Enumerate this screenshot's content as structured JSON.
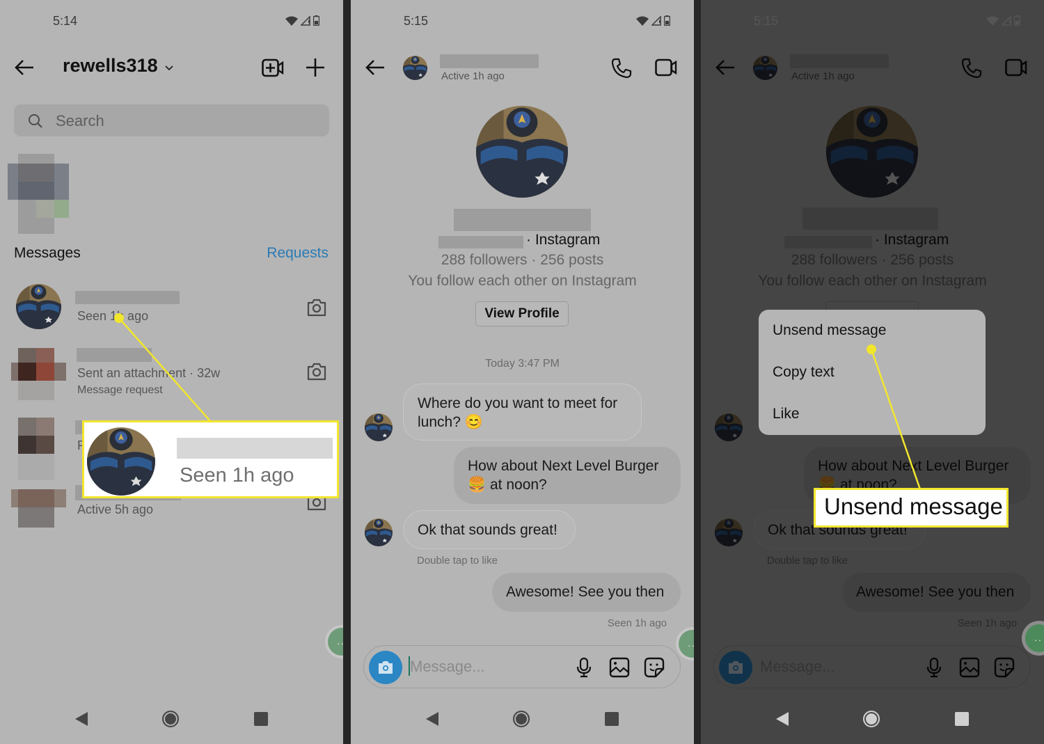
{
  "panel1": {
    "status_time": "5:14",
    "header_title": "rewells318",
    "search_placeholder": "Search",
    "section_heading": "Messages",
    "requests_link": "Requests",
    "conversations": [
      {
        "status": "Seen 1h ago"
      },
      {
        "status": "Sent an attachment · 32w",
        "sub": "Message request"
      },
      {
        "status": "F"
      },
      {
        "status": "Active 5h ago"
      }
    ],
    "callout_text": "Seen 1h ago",
    "icons": {
      "back": "arrow-left-icon",
      "chevron": "chevron-down-icon",
      "new_video": "video-plus-icon",
      "new_message": "plus-icon",
      "search": "search-icon",
      "camera": "camera-icon"
    }
  },
  "panel2": {
    "status_time": "5:15",
    "header_status": "Active 1h ago",
    "profile_source": "· Instagram",
    "profile_stats": "288 followers · 256 posts",
    "profile_follow": "You follow each other on Instagram",
    "view_profile_button": "View Profile",
    "timestamp": "Today 3:47 PM",
    "messages": [
      {
        "direction": "in",
        "line1": "Where do you want to meet for",
        "line2": "lunch? 😊"
      },
      {
        "direction": "out",
        "line1": "How about Next Level Burger",
        "line2": "🍔 at noon?"
      },
      {
        "direction": "in",
        "line1": "Ok that sounds great!"
      },
      {
        "direction": "out",
        "line1": "Awesome! See you then"
      }
    ],
    "double_tap_hint": "Double tap to like",
    "seen_status": "Seen 1h ago",
    "composer_placeholder": "Message..."
  },
  "panel3": {
    "status_time": "5:15",
    "header_status": "Active 1h ago",
    "profile_source": "· Instagram",
    "profile_stats": "288 followers · 256 posts",
    "profile_follow": "You follow each other on Instagram",
    "menu": [
      "Unsend message",
      "Copy text",
      "Like"
    ],
    "messages": [
      {
        "line1": "How about Next Level Burger",
        "line2": "🍔 at noon?"
      },
      {
        "line1": "Ok that sounds great!"
      },
      {
        "line1": "Awesome! See you then"
      }
    ],
    "double_tap_hint": "Double tap to like",
    "seen_status": "Seen 1h ago",
    "composer_placeholder": "Message...",
    "callout_text": "Unsend message"
  },
  "colors": {
    "accent_blue": "#2a7bb6",
    "camera_blue": "#2b86c4",
    "callout_yellow": "#f2e62d",
    "fab_green": "#6f9c78"
  }
}
